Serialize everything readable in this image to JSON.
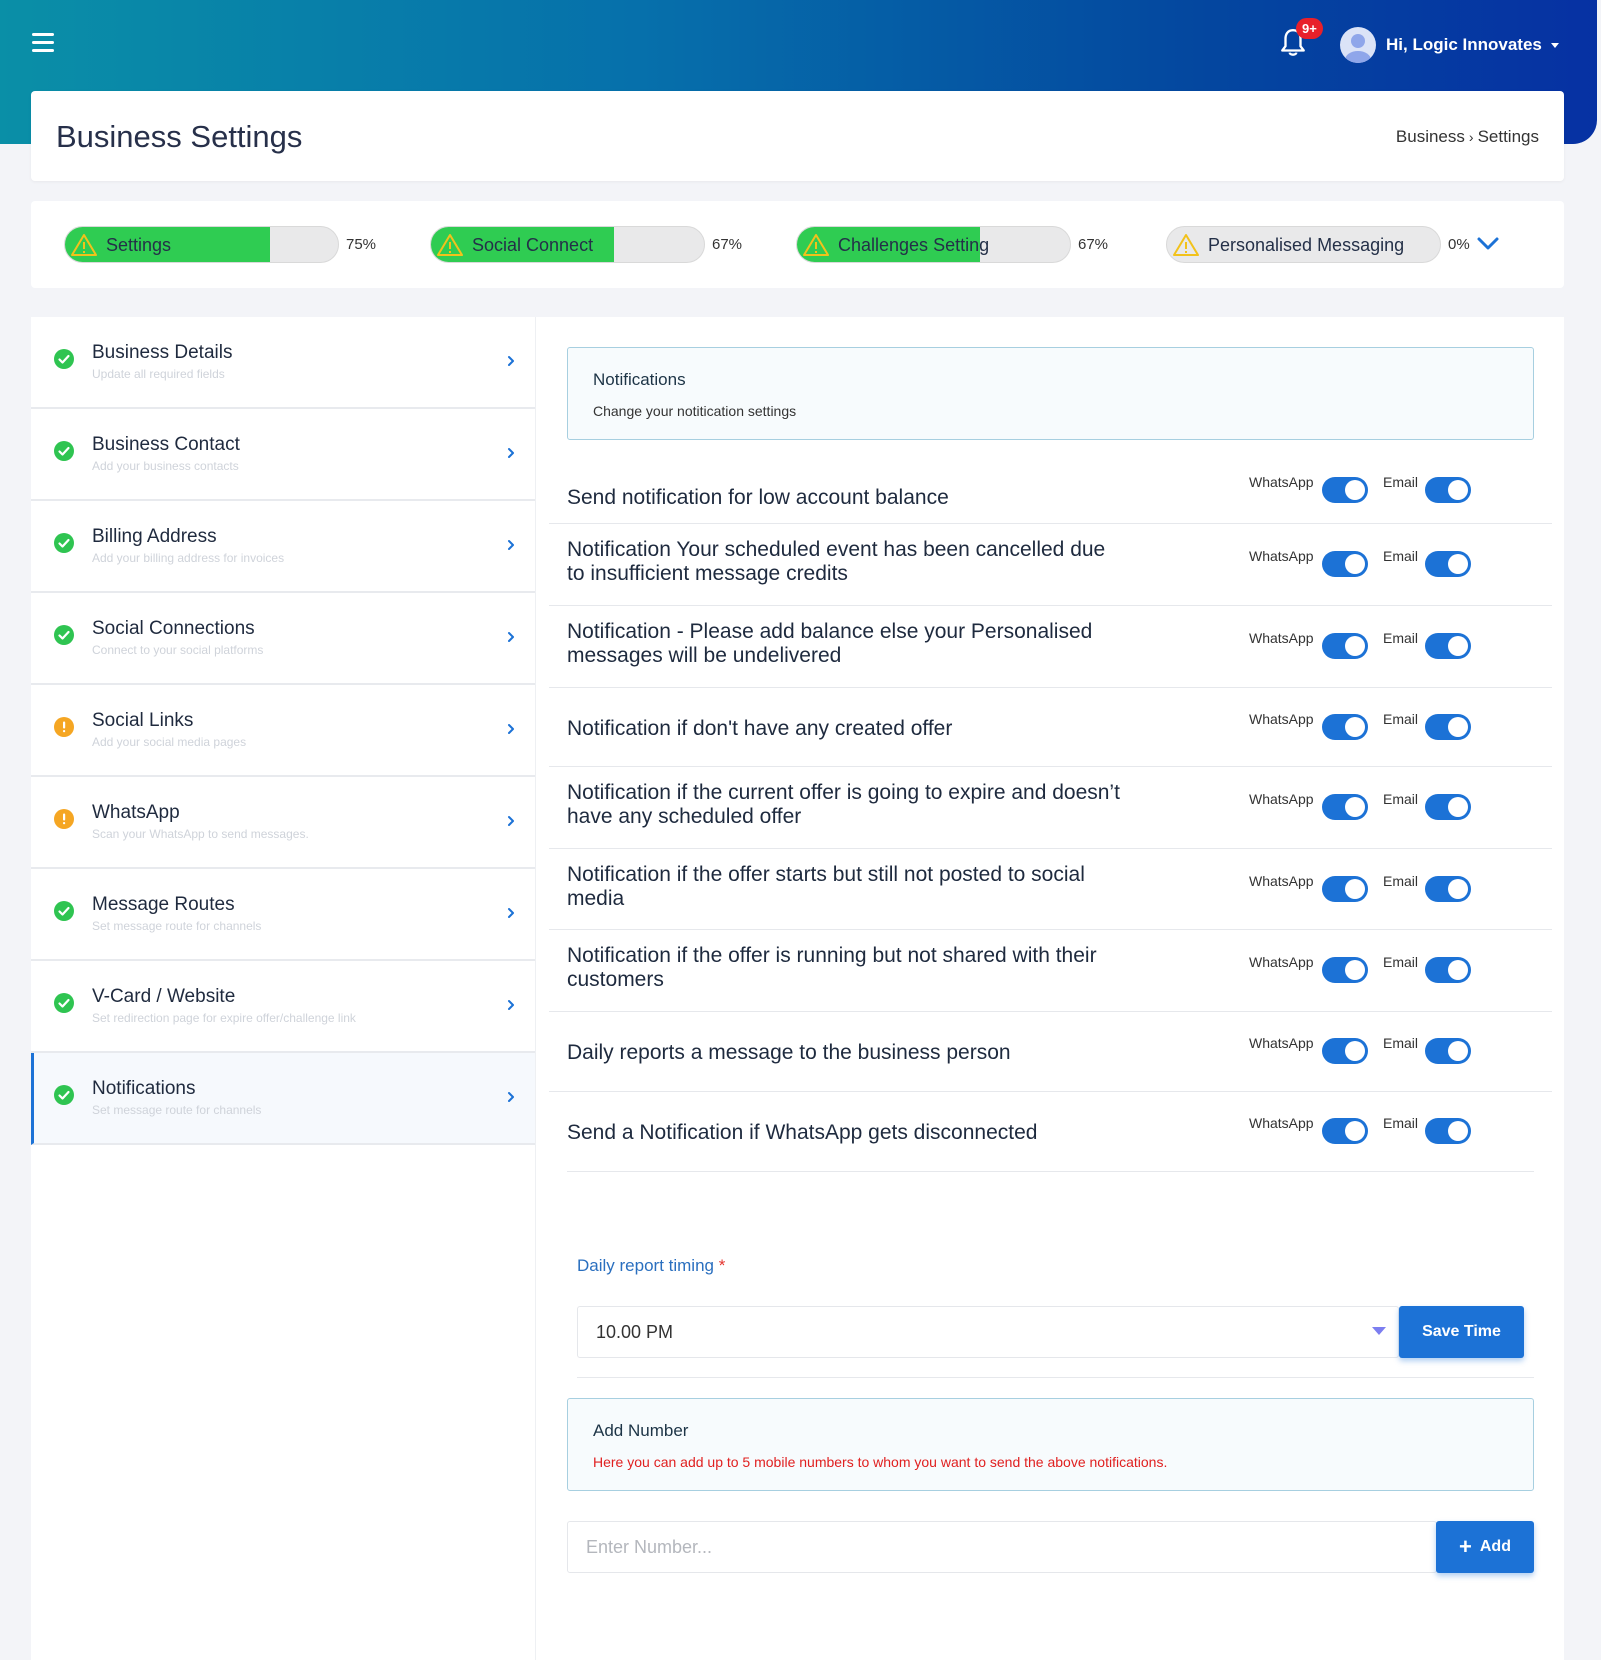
{
  "header": {
    "notification_badge": "9+",
    "user_greeting": "Hi, Logic Innovates"
  },
  "page": {
    "title": "Business Settings",
    "breadcrumb": {
      "parent": "Business",
      "separator": "›",
      "current": "Settings"
    }
  },
  "progress": [
    {
      "label": "Settings",
      "percent_text": "75%",
      "value": 0.75
    },
    {
      "label": "Social Connect",
      "percent_text": "67%",
      "value": 0.67
    },
    {
      "label": "Challenges Setting",
      "percent_text": "67%",
      "value": 0.67
    },
    {
      "label": "Personalised Messaging",
      "percent_text": "0%",
      "value": 0
    }
  ],
  "sidebar": {
    "items": [
      {
        "title": "Business Details",
        "subtitle": "Update all required fields",
        "status": "complete"
      },
      {
        "title": "Business Contact",
        "subtitle": "Add your business contacts",
        "status": "complete"
      },
      {
        "title": "Billing Address",
        "subtitle": "Add your billing address for invoices",
        "status": "complete"
      },
      {
        "title": "Social Connections",
        "subtitle": "Connect to your social platforms",
        "status": "complete"
      },
      {
        "title": "Social Links",
        "subtitle": "Add your social media pages",
        "status": "warning"
      },
      {
        "title": "WhatsApp",
        "subtitle": "Scan your WhatsApp to send messages.",
        "status": "warning"
      },
      {
        "title": "Message Routes",
        "subtitle": "Set message route for channels",
        "status": "complete"
      },
      {
        "title": "V-Card / Website",
        "subtitle": "Set redirection page for expire offer/challenge link",
        "status": "complete"
      },
      {
        "title": "Notifications",
        "subtitle": "Set message route for channels",
        "status": "complete",
        "active": true
      }
    ]
  },
  "notifications_panel": {
    "title": "Notifications",
    "description": "Change your notitication settings",
    "whatsapp_label": "WhatsApp",
    "email_label": "Email",
    "rows": [
      {
        "text": "Send notification for low account balance",
        "whatsapp": true,
        "email": true
      },
      {
        "text": "Notification Your scheduled event has been cancelled due to insufficient message credits",
        "whatsapp": true,
        "email": true
      },
      {
        "text": "Notification - Please add balance else your Personalised messages will be undelivered",
        "whatsapp": true,
        "email": true
      },
      {
        "text": "Notification if don't have any created offer",
        "whatsapp": true,
        "email": true
      },
      {
        "text": "Notification if the current offer is going to expire and doesn’t have any scheduled offer",
        "whatsapp": true,
        "email": true
      },
      {
        "text": "Notification if the offer starts but still not posted to social media",
        "whatsapp": true,
        "email": true
      },
      {
        "text": "Notification if the offer is running but not shared with their customers",
        "whatsapp": true,
        "email": true
      },
      {
        "text": "Daily reports a message to the business person",
        "whatsapp": true,
        "email": true
      },
      {
        "text": "Send a Notification if WhatsApp gets disconnected",
        "whatsapp": true,
        "email": true
      }
    ]
  },
  "daily_report": {
    "label": "Daily report timing",
    "required_mark": "*",
    "selected_time": "10.00 PM",
    "save_label": "Save Time"
  },
  "add_number": {
    "title": "Add Number",
    "description": "Here you can add up to 5 mobile numbers to whom you want to send the above notifications.",
    "placeholder": "Enter Number...",
    "button_label": "Add"
  },
  "colors": {
    "accent": "#1c72d6",
    "progress_fill": "#2fcc52",
    "success": "#2fc451",
    "warning": "#f5a623"
  }
}
